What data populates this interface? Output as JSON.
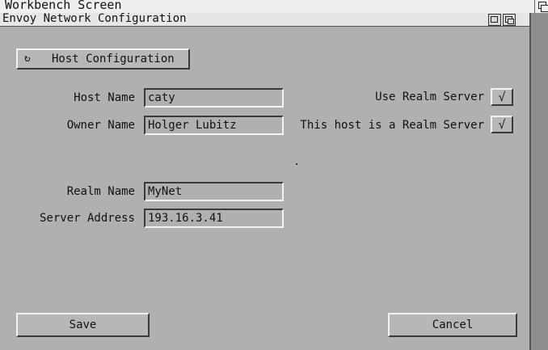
{
  "screen": {
    "title": "Workbench Screen"
  },
  "window": {
    "title": "Envoy Network Configuration"
  },
  "page_cycle": {
    "label": "Host Configuration",
    "icon": "cycle-icon"
  },
  "fields": {
    "host_name": {
      "label": "Host Name",
      "value": "caty"
    },
    "owner_name": {
      "label": "Owner Name",
      "value": "Holger Lubitz"
    },
    "realm_name": {
      "label": "Realm Name",
      "value": "MyNet"
    },
    "server_address": {
      "label": "Server Address",
      "value": "193.16.3.41"
    }
  },
  "checkboxes": {
    "use_realm_server": {
      "label": "Use Realm Server",
      "checked": true,
      "mark": "√"
    },
    "is_realm_server": {
      "label": "This host is a Realm Server",
      "checked": true,
      "mark": "√"
    }
  },
  "buttons": {
    "save": "Save",
    "cancel": "Cancel"
  }
}
